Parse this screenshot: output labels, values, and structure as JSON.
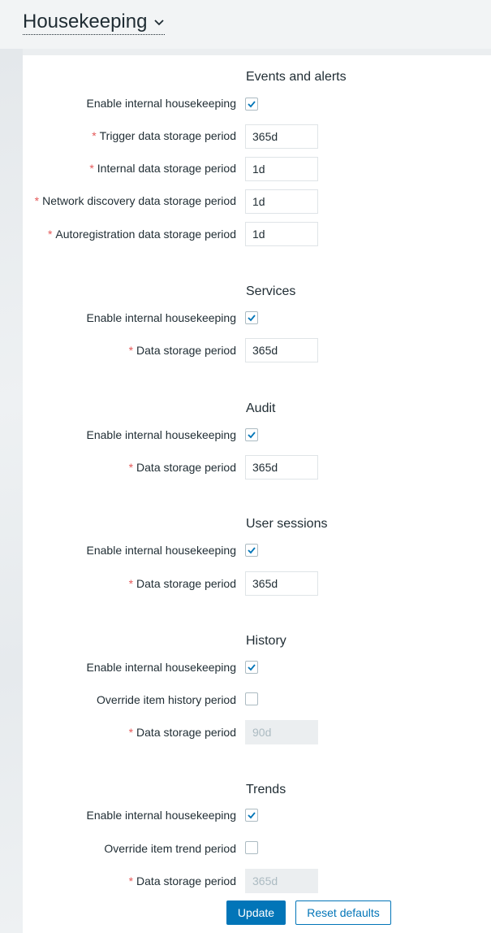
{
  "header": {
    "title": "Housekeeping"
  },
  "sections": {
    "events": {
      "title": "Events and alerts",
      "enable_label": "Enable internal housekeeping",
      "trigger_label": "Trigger data storage period",
      "trigger_value": "365d",
      "internal_label": "Internal data storage period",
      "internal_value": "1d",
      "network_label": "Network discovery data storage period",
      "network_value": "1d",
      "autoreg_label": "Autoregistration data storage period",
      "autoreg_value": "1d"
    },
    "services": {
      "title": "Services",
      "enable_label": "Enable internal housekeeping",
      "period_label": "Data storage period",
      "period_value": "365d"
    },
    "audit": {
      "title": "Audit",
      "enable_label": "Enable internal housekeeping",
      "period_label": "Data storage period",
      "period_value": "365d"
    },
    "user_sessions": {
      "title": "User sessions",
      "enable_label": "Enable internal housekeeping",
      "period_label": "Data storage period",
      "period_value": "365d"
    },
    "history": {
      "title": "History",
      "enable_label": "Enable internal housekeeping",
      "override_label": "Override item history period",
      "period_label": "Data storage period",
      "period_value": "90d"
    },
    "trends": {
      "title": "Trends",
      "enable_label": "Enable internal housekeeping",
      "override_label": "Override item trend period",
      "period_label": "Data storage period",
      "period_value": "365d"
    }
  },
  "buttons": {
    "update": "Update",
    "reset": "Reset defaults"
  },
  "required_marker": "*",
  "colors": {
    "accent": "#0275b8",
    "required": "#e45959",
    "text": "#1f2c33"
  }
}
